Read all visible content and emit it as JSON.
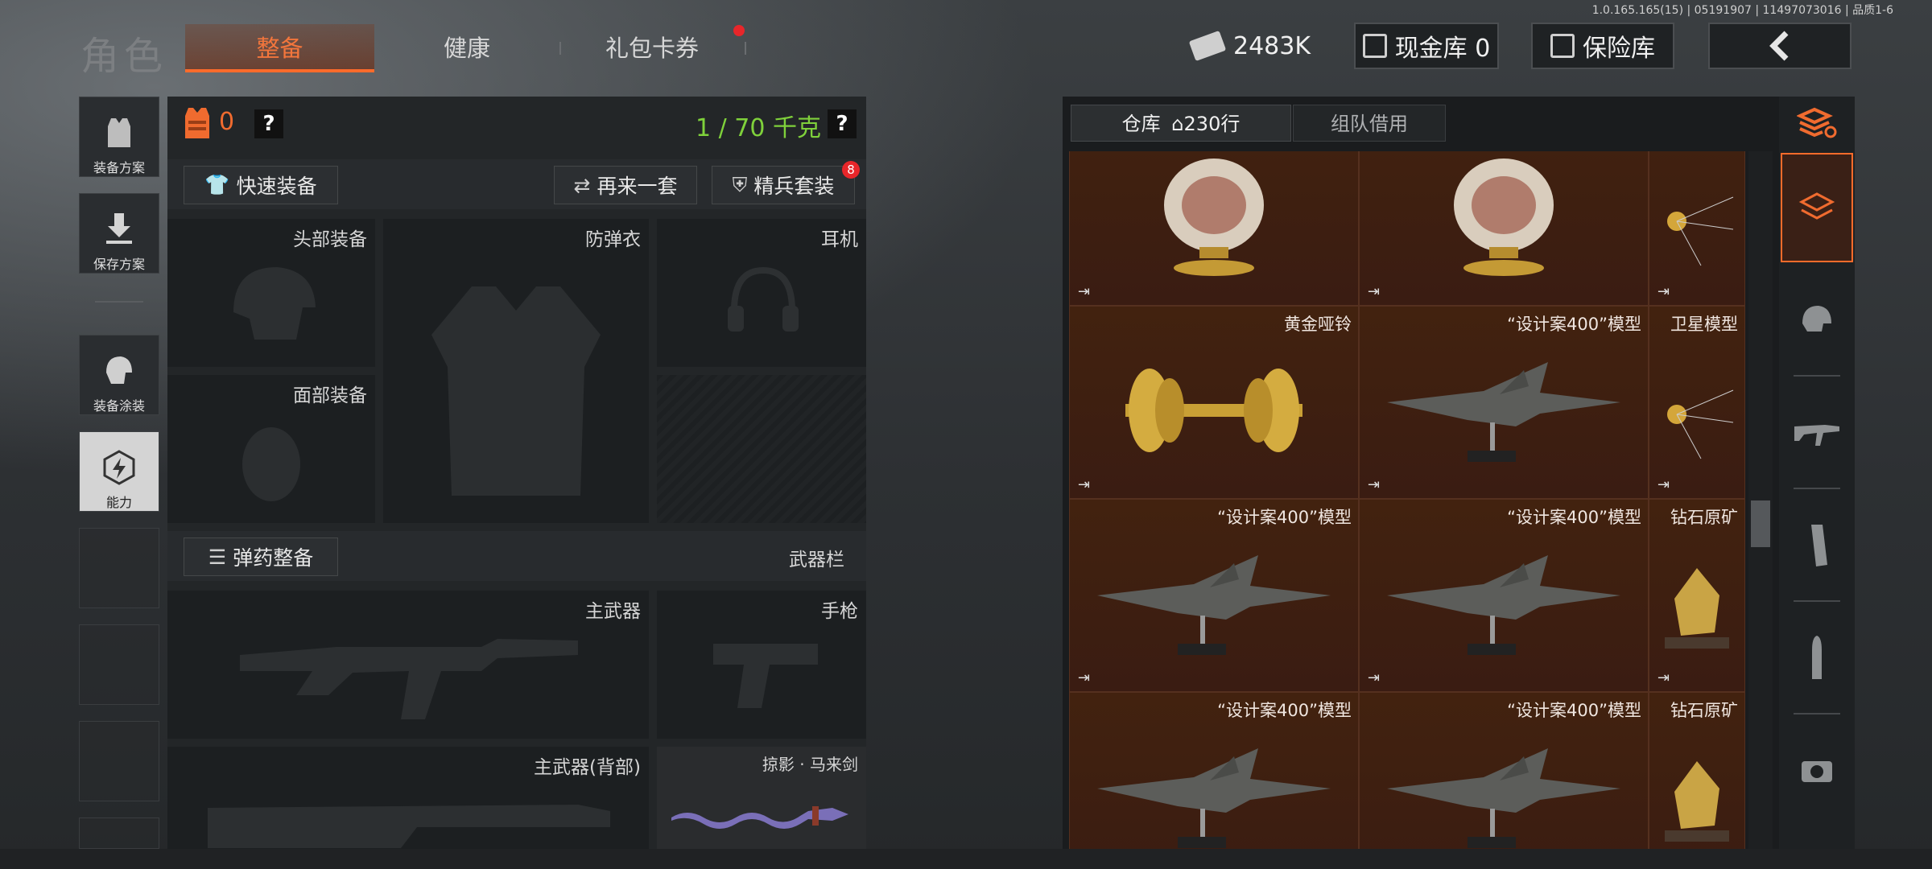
{
  "version": "1.0.165.165(15) | 05191907 | 11497073016 | 品质1-6",
  "title": "角色",
  "tabs": {
    "equip": "整备",
    "health": "健康",
    "gift": "礼包卡券"
  },
  "header": {
    "money": "2483K",
    "cash_vault": "现金库 0",
    "safe": "保险库"
  },
  "left_nav": {
    "plan": "装备方案",
    "save": "保存方案",
    "paint": "装备涂装",
    "ability": "能力"
  },
  "equip": {
    "armor_count": "0",
    "weight": "1 / 70 千克",
    "quick_equip": "快速装备",
    "again": "再来一套",
    "elite": "精兵套装",
    "elite_badge": "8",
    "slots": {
      "head": "头部装备",
      "vest": "防弹衣",
      "headset": "耳机",
      "face": "面部装备"
    },
    "ammo": "弹药整备",
    "weapon_bar": "武器栏",
    "weapons": {
      "primary": "主武器",
      "pistol": "手枪",
      "primary_back": "主武器(背部)",
      "melee": "掠影 · 马来剑"
    }
  },
  "warehouse": {
    "tab_warehouse": "仓库",
    "rows": "230行",
    "tab_team": "组队借用",
    "items": [
      {
        "name": "",
        "kind": "vase"
      },
      {
        "name": "",
        "kind": "vase"
      },
      {
        "name": "卫星模型",
        "kind": "satellite"
      },
      {
        "name": "黄金哑铃",
        "kind": "dumbbell"
      },
      {
        "name": "“设计案400”模型",
        "kind": "jet"
      },
      {
        "name": "卫星模型",
        "kind": "satellite"
      },
      {
        "name": "“设计案400”模型",
        "kind": "jet"
      },
      {
        "name": "“设计案400”模型",
        "kind": "jet"
      },
      {
        "name": "钻石原矿",
        "kind": "ore"
      },
      {
        "name": "“设计案400”模型",
        "kind": "jet"
      },
      {
        "name": "“设计案400”模型",
        "kind": "jet"
      },
      {
        "name": "钻石原矿",
        "kind": "ore"
      }
    ]
  },
  "colors": {
    "accent": "#f3763c",
    "weight_green": "#7fd13b",
    "badge_red": "#e8262a",
    "grid_bg": "#3b1d14"
  }
}
